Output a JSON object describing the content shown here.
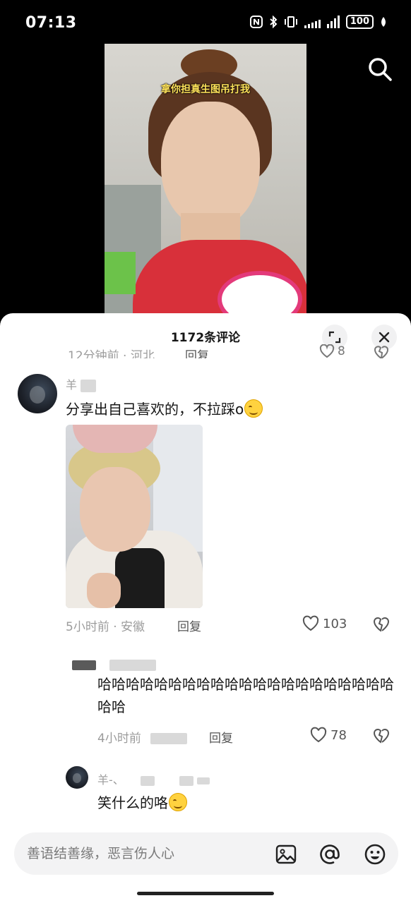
{
  "status_bar": {
    "time": "07:13",
    "battery": "100",
    "icons": [
      "nfc-icon",
      "bluetooth-icon",
      "vibrate-icon",
      "signal-icon",
      "signal-icon",
      "battery-icon",
      "leaf-icon"
    ]
  },
  "video": {
    "caption": "拿你担真生图吊打我",
    "search_icon": "search-icon"
  },
  "sheet": {
    "title": "1172条评论",
    "expand_icon": "expand-icon",
    "close_icon": "close-icon"
  },
  "previous_comment": {
    "meta": "12分钟前 · 河北",
    "reply": "回复",
    "likes": "8"
  },
  "comments": [
    {
      "username": "羊",
      "text": "分享出自己喜欢的，不拉踩o",
      "has_image": true,
      "time": "5小时前",
      "location": "安徽",
      "reply": "回复",
      "likes": "103"
    },
    {
      "username": "",
      "text": "哈哈哈哈哈哈哈哈哈哈哈哈哈哈哈哈哈哈哈哈哈哈哈",
      "time": "4小时前",
      "reply": "回复",
      "likes": "78"
    },
    {
      "username": "羊-、",
      "text": "笑什么的咯"
    }
  ],
  "input": {
    "placeholder": "善语结善缘，恶言伤人心",
    "icons": [
      "image-icon",
      "at-icon",
      "emoji-icon"
    ]
  },
  "colors": {
    "text": "#161616",
    "meta": "#9c9c9c",
    "sheet_bg": "#ffffff",
    "page_bg": "#000000"
  }
}
